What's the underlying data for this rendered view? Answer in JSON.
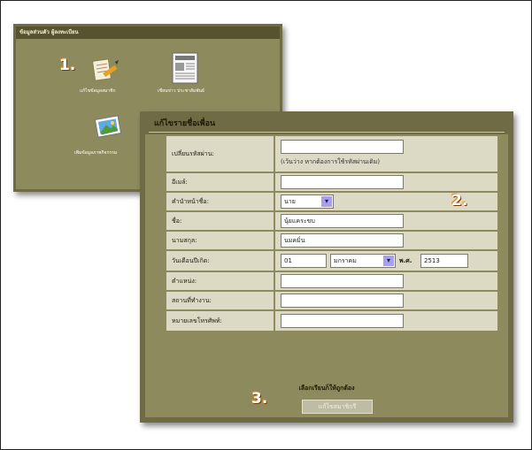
{
  "steps": {
    "one": "1.",
    "two": "2.",
    "three": "3."
  },
  "menu_panel": {
    "header": "ข้อมูลส่วนตัว ผู้ลงทะเบียน",
    "items": [
      {
        "label": "แก้ไขข้อมูลสมาชิก"
      },
      {
        "label": "เขียนข่าว ประชาสัมพันธ์"
      },
      {
        "label": "เพิ่มข้อมูลภาพกิจกรรม"
      }
    ]
  },
  "form": {
    "title": "แก้ไขรายชื่อเพื่อน",
    "fields": [
      {
        "label": "เปลี่ยนรหัสผ่าน:",
        "value": "",
        "hint": "(เว้นว่าง หากต้องการใช้รหัสผ่านเดิม)"
      },
      {
        "label": "อีเมล์:",
        "value": ""
      },
      {
        "label": "คำนำหน้าชื่อ:",
        "value": "นาย"
      },
      {
        "label": "ชื่อ:",
        "value": "นุ้ยแคระขบ"
      },
      {
        "label": "นามสกุล:",
        "value": "นมคมิ่น"
      },
      {
        "label": "วันเดือนปีเกิด:",
        "day": "01",
        "month": "มกราคม",
        "era": "พ.ศ.",
        "year": "2513"
      },
      {
        "label": "ตำแหน่ง:",
        "value": ""
      },
      {
        "label": "สถานที่ทำงาน:",
        "value": ""
      },
      {
        "label": "หมายเลขโทรศัพท์:",
        "value": ""
      }
    ],
    "note": "เลือกเรียนก็ให้ถูกต้อง",
    "submit": "แก้ไขสมาชิกรี"
  }
}
